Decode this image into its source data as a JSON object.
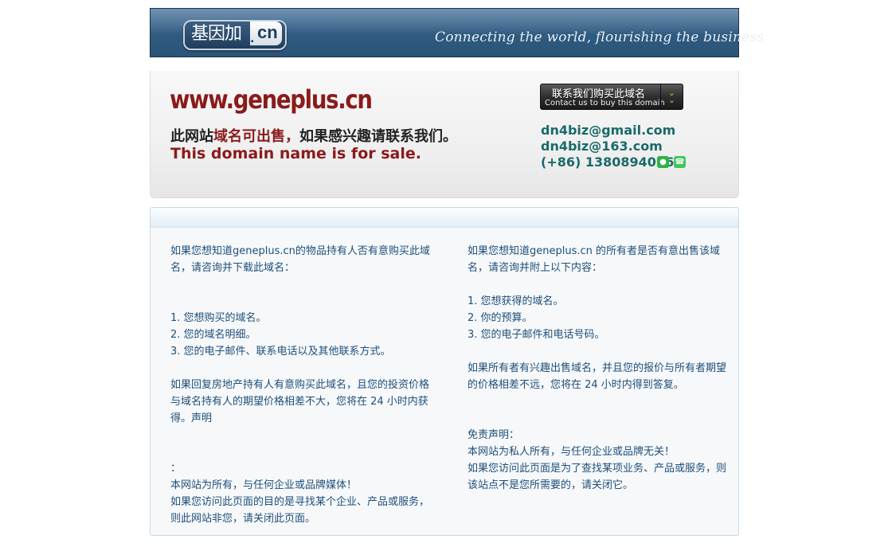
{
  "header": {
    "logo_main": "基因加",
    "logo_dot": ".",
    "logo_suffix": "cn",
    "tagline": "Connecting the world, flourishing  the business"
  },
  "sale": {
    "domain": "www.geneplus.cn",
    "cn_prefix": "此网站",
    "cn_highlight": "域名可出售，",
    "cn_suffix": "如果感兴趣请联系我们。",
    "en_text": "This domain name is for sale.",
    "contact_button": {
      "cn_label": "联系我们购买此域名",
      "en_label": "Contact us to buy this domain",
      "icon": "double-chevron-down-icon"
    },
    "emails": [
      "dn4biz@gmail.com",
      "dn4biz@163.com"
    ],
    "phone": "(+86) 13808940166",
    "icons": [
      "wechat-icon",
      "whatsapp-icon"
    ],
    "colors": {
      "domain_red": "#8b1a1a",
      "contact_teal": "#1a6a6a"
    }
  },
  "info": {
    "left": {
      "intro": "如果您想知道geneplus.cn的物品持有人否有意购买此域名，请咨询并下载此域名：",
      "items": [
        "1. 您想购买的域名。",
        "2. 您的域名明细。",
        "3. 您的电子邮件、联系电话以及其他联系方式。"
      ],
      "para2": "如果回复房地产持有人有意购买此域名，且您的投资价格与域名持有人的期望价格相差不大，您将在 24 小时内获得。声明",
      "colon": "：",
      "disclaimer1": "本网站为所有，与任何企业或品牌媒体！",
      "disclaimer2": "如果您访问此页面的目的是寻找某个企业、产品或服务，则此网站非您，请关闭此页面。"
    },
    "right": {
      "intro": "如果您想知道geneplus.cn 的所有者是否有意出售该域名，请咨询并附上以下内容：",
      "items": [
        "1. 您想获得的域名。",
        "2. 你的预算。",
        "3. 您的电子邮件和电话号码。"
      ],
      "para2": "如果所有者有兴趣出售域名，并且您的报价与所有者期望的价格相差不远，您将在 24 小时内得到答复。",
      "disclaimer_title": "免责声明：",
      "disclaimer1": "本网站为私人所有，与任何企业或品牌无关！",
      "disclaimer2": "如果您访问此页面是为了查找某项业务、产品或服务，则该站点不是您所需要的，请关闭它。"
    }
  }
}
